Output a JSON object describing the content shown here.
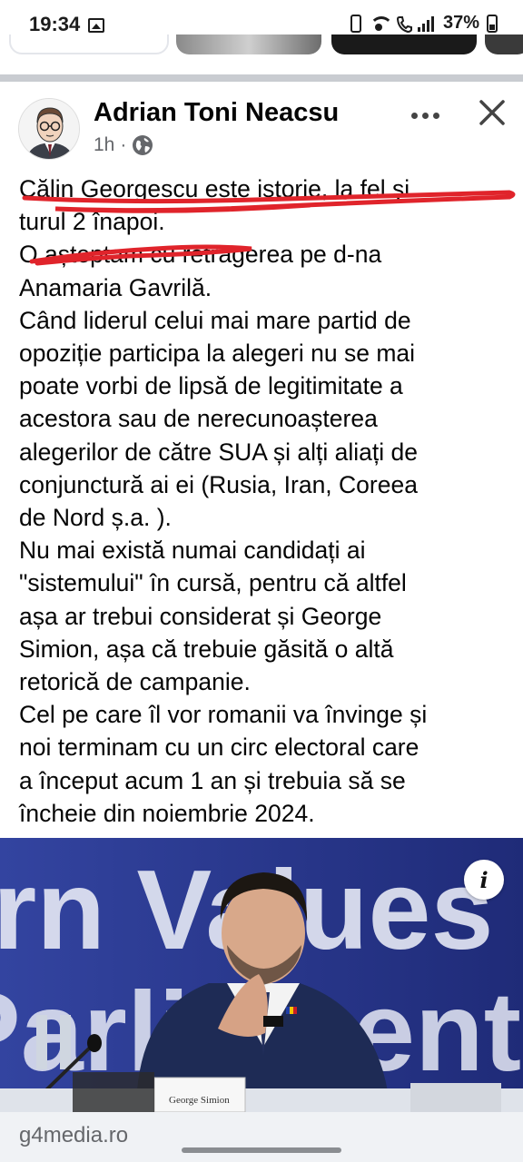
{
  "status_bar": {
    "time": "19:34",
    "battery_percent": "37%",
    "icons": [
      "gallery-icon",
      "battery-saver-icon",
      "wifi-icon",
      "call-icon",
      "signal-icon",
      "battery-icon"
    ]
  },
  "post": {
    "author": "Adrian Toni Neacsu",
    "time_ago": "1h",
    "separator": "·",
    "audience_icon": "globe-icon",
    "more_icon": "more-dots-icon",
    "close_icon": "close-icon",
    "lines": [
      "Călin Georgescu este istorie, la fel și",
      "turul 2 înapoi.",
      "O așteptam cu retragerea pe d-na",
      "Anamaria Gavrilă.",
      "Când liderul celui mai mare partid de",
      "opoziție  participa la alegeri nu se mai",
      "poate vorbi de lipsă de legitimitate a",
      "acestora sau de nerecunoașterea",
      "alegerilor de către SUA și alți aliați de",
      "conjunctură ai ei (Rusia, Iran, Coreea",
      "de Nord ș.a. ).",
      "Nu mai există numai candidați ai",
      "\"sistemului\" în cursă, pentru că altfel",
      "așa ar trebui considerat și George",
      "Simion, așa că trebuie găsită o altă",
      "retorică de campanie.",
      "Cel pe care îl vor romanii va învinge și",
      "noi terminam cu un circ electoral care",
      "a început acum 1 an și trebuia să se",
      "încheie din noiembrie 2024."
    ],
    "scribble_color": "#e0242b",
    "photo": {
      "background_text_line1": "rn Values",
      "background_text_line2": "Parliament",
      "nameplate": "George Simion",
      "info_label": "i"
    },
    "link_domain": "g4media.ro"
  },
  "colors": {
    "text": "#050505",
    "meta": "#65676b",
    "divider": "#c9ccd1",
    "photo_bg": "#2c3a8c",
    "footer_bg": "#f0f2f5"
  }
}
